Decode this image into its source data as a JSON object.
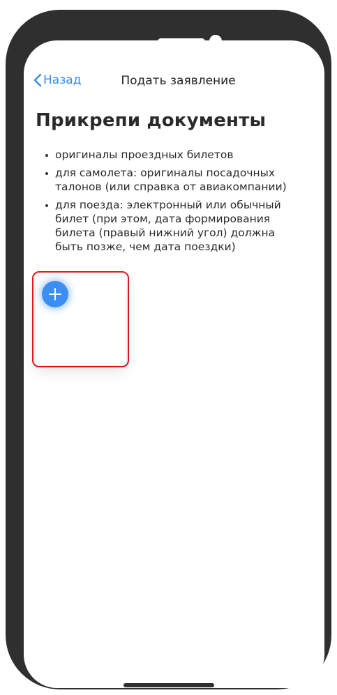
{
  "nav": {
    "back_label": "Назад",
    "title": "Подать заявление"
  },
  "page": {
    "heading": "Прикрепи документы",
    "requirements": [
      "оригиналы проездных билетов",
      "для самолета: оригиналы посадочных талонов (или справка от авиакомпании)",
      "для поезда: электронный или обычный билет (при этом, дата формирования билета (правый нижний угол) должна быть позже, чем дата поездки)"
    ]
  },
  "upload": {
    "add_icon": "plus-icon"
  },
  "colors": {
    "accent": "#2f8df0",
    "add_button": "#3b8ef2",
    "highlight": "#e31b1b",
    "frame": "#2f2f2f"
  }
}
